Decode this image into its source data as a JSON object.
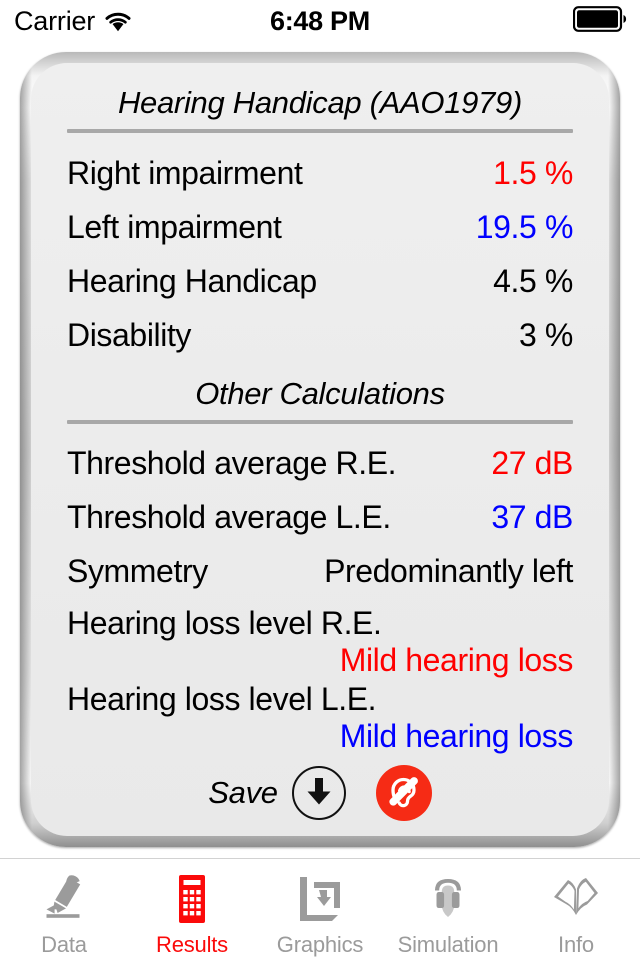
{
  "status_bar": {
    "carrier": "Carrier",
    "wifi_icon": "wifi-icon",
    "time": "6:48 PM",
    "battery_icon": "battery-full-icon"
  },
  "panel": {
    "primary_section": {
      "title": "Hearing Handicap (AAO1979)",
      "rows": [
        {
          "label": "Right impairment",
          "value": "1.5 %",
          "color": "#ff0000"
        },
        {
          "label": "Left impairment",
          "value": "19.5 %",
          "color": "#0000ff"
        },
        {
          "label": "Hearing Handicap",
          "value": "4.5 %",
          "color": "#000000"
        },
        {
          "label": "Disability",
          "value": "3 %",
          "color": "#000000"
        }
      ]
    },
    "secondary_section": {
      "title": "Other Calculations",
      "rows": [
        {
          "label": "Threshold average R.E.",
          "value": "27 dB",
          "color": "#ff0000"
        },
        {
          "label": "Threshold average L.E.",
          "value": "37 dB",
          "color": "#0000ff"
        },
        {
          "label": "Symmetry",
          "value": "Predominantly left",
          "color": "#000000"
        }
      ],
      "wrapped_rows": [
        {
          "label": "Hearing loss level R.E.",
          "value": "Mild hearing loss",
          "color": "#ff0000"
        },
        {
          "label": "Hearing loss level L.E.",
          "value": "Mild hearing loss",
          "color": "#0000ff"
        }
      ]
    },
    "actions": {
      "save_label": "Save",
      "save_icon": "download-arrow-icon",
      "deaf_badge_icon": "deaf-ear-icon",
      "deaf_badge_color": "#f62b15"
    }
  },
  "tab_bar": {
    "active_color": "#fb0a0a",
    "inactive_color": "#9b9b9b",
    "tabs": [
      {
        "label": "Data",
        "icon": "pencil-icon",
        "active": false
      },
      {
        "label": "Results",
        "icon": "calculator-icon",
        "active": true
      },
      {
        "label": "Graphics",
        "icon": "crop-frame-icon",
        "active": false
      },
      {
        "label": "Simulation",
        "icon": "headphones-icon",
        "active": false
      },
      {
        "label": "Info",
        "icon": "open-book-icon",
        "active": false
      }
    ]
  }
}
